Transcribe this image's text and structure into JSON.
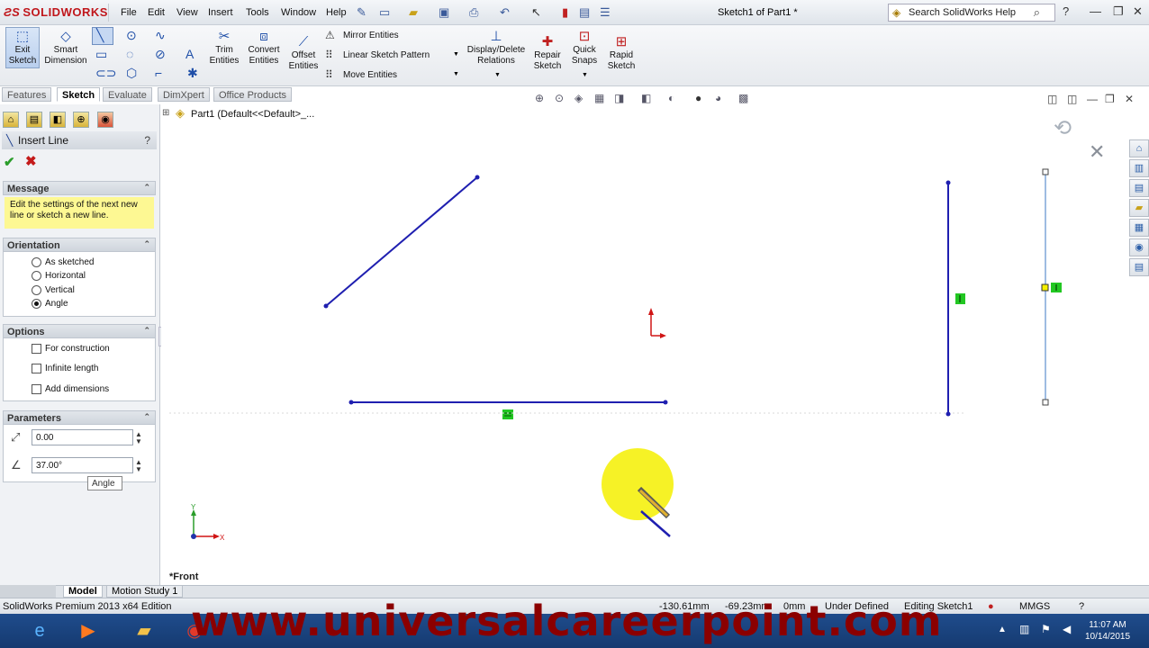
{
  "app": {
    "logo_text": "SOLIDWORKS",
    "document_title": "Sketch1 of Part1 *",
    "menu": [
      "File",
      "Edit",
      "View",
      "Insert",
      "Tools",
      "Window",
      "Help"
    ],
    "help_search_placeholder": "Search SolidWorks Help"
  },
  "command_manager": {
    "exit_sketch": "Exit\nSketch",
    "smart_dimension": "Smart\nDimension",
    "trim_entities": "Trim\nEntities",
    "convert_entities": "Convert\nEntities",
    "offset_entities": "Offset\nEntities",
    "mirror_entities": "Mirror Entities",
    "linear_sketch_pattern": "Linear Sketch Pattern",
    "move_entities": "Move Entities",
    "display_delete_relations": "Display/Delete\nRelations",
    "repair_sketch": "Repair\nSketch",
    "quick_snaps": "Quick\nSnaps",
    "rapid_sketch": "Rapid\nSketch"
  },
  "tabs": [
    "Features",
    "Sketch",
    "Evaluate",
    "DimXpert",
    "Office Products"
  ],
  "property_manager": {
    "title": "Insert Line",
    "help": "?",
    "message_header": "Message",
    "message_text": "Edit the settings of the next new line or sketch a new line.",
    "orientation_header": "Orientation",
    "orientation_options": [
      "As sketched",
      "Horizontal",
      "Vertical",
      "Angle"
    ],
    "orientation_selected": "Angle",
    "options_header": "Options",
    "options": [
      "For construction",
      "Infinite length",
      "Add dimensions"
    ],
    "parameters_header": "Parameters",
    "length_value": "0.00",
    "angle_value": "37.00°",
    "angle_tooltip": "Angle"
  },
  "graphics": {
    "breadcrumb": "Part1  (Default<<Default>_...",
    "view_label": "*Front"
  },
  "bottom_tabs": [
    "Model",
    "Motion Study 1"
  ],
  "status": {
    "edition": "SolidWorks Premium 2013 x64 Edition",
    "x": "-130.61mm",
    "y": "-69.23mm",
    "z": "0mm",
    "state": "Under Defined",
    "editing": "Editing Sketch1",
    "units": "MMGS"
  },
  "taskbar": {
    "time": "11:07 AM",
    "date": "10/14/2015"
  },
  "watermark": "www.universalcareerpoint.com",
  "colors": {
    "sketch_line": "#1f1fb0",
    "selected_line": "#7fa6d8",
    "relation_icon": "#22c722",
    "highlight": "#f5f000"
  }
}
